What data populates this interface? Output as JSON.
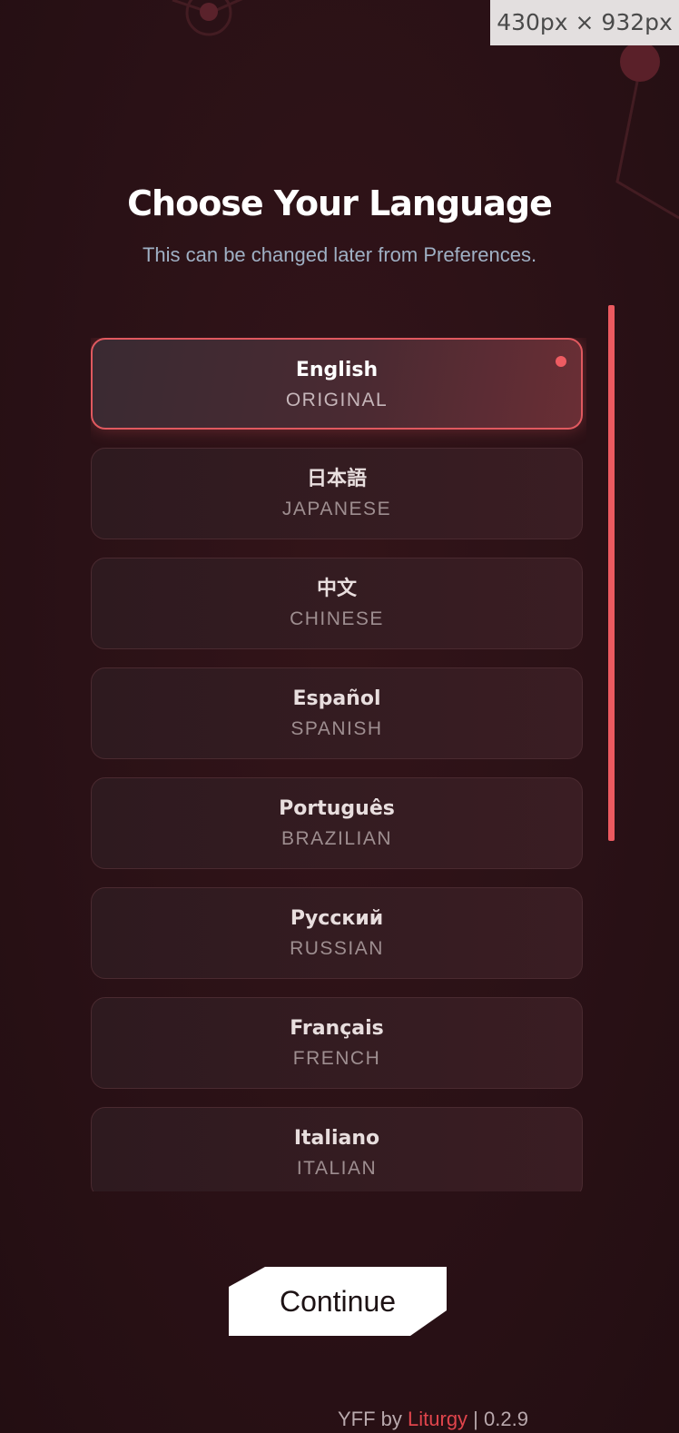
{
  "viewport_badge": "430px × 932px",
  "header": {
    "title": "Choose Your Language",
    "subtitle": "This can be changed later from Preferences."
  },
  "languages": [
    {
      "native": "English",
      "english": "ORIGINAL",
      "selected": true
    },
    {
      "native": "日本語",
      "english": "JAPANESE",
      "selected": false
    },
    {
      "native": "中文",
      "english": "CHINESE",
      "selected": false
    },
    {
      "native": "Español",
      "english": "SPANISH",
      "selected": false
    },
    {
      "native": "Português",
      "english": "BRAZILIAN",
      "selected": false
    },
    {
      "native": "Русский",
      "english": "RUSSIAN",
      "selected": false
    },
    {
      "native": "Français",
      "english": "FRENCH",
      "selected": false
    },
    {
      "native": "Italiano",
      "english": "ITALIAN",
      "selected": false
    }
  ],
  "continue_label": "Continue",
  "footer": {
    "app": "YFF by ",
    "brand": "Liturgy",
    "version": " | 0.2.9"
  },
  "colors": {
    "background": "#2a1116",
    "accent": "#ec5a60",
    "selected_border": "#e0595f"
  }
}
